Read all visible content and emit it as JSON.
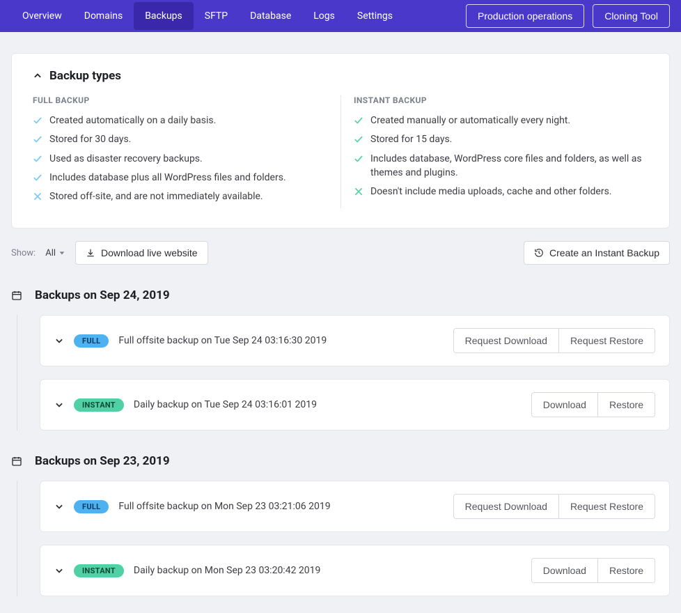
{
  "nav": {
    "items": [
      "Overview",
      "Domains",
      "Backups",
      "SFTP",
      "Database",
      "Logs",
      "Settings"
    ],
    "active_index": 2,
    "right_buttons": [
      "Production operations",
      "Cloning Tool"
    ]
  },
  "panel": {
    "title": "Backup types",
    "full": {
      "heading": "FULL BACKUP",
      "items": [
        {
          "ok": true,
          "text": "Created automatically on a daily basis."
        },
        {
          "ok": true,
          "text": "Stored for 30 days."
        },
        {
          "ok": true,
          "text": "Used as disaster recovery backups."
        },
        {
          "ok": true,
          "text": "Includes database plus all WordPress files and folders."
        },
        {
          "ok": false,
          "text": "Stored off-site, and are not immediately available."
        }
      ]
    },
    "instant": {
      "heading": "INSTANT BACKUP",
      "items": [
        {
          "ok": true,
          "text": "Created manually or automatically every night."
        },
        {
          "ok": true,
          "text": "Stored for 15 days."
        },
        {
          "ok": true,
          "text": "Includes database, WordPress core files and folders, as well as themes and plugins."
        },
        {
          "ok": false,
          "text": "Doesn't include media uploads, cache and other folders."
        }
      ]
    }
  },
  "toolbar": {
    "show_label": "Show:",
    "show_value": "All",
    "download_live": "Download live website",
    "create_instant": "Create an Instant Backup"
  },
  "groups": [
    {
      "heading": "Backups on Sep 24, 2019",
      "rows": [
        {
          "kind": "FULL",
          "text": "Full offsite backup on Tue Sep 24 03:16:30 2019",
          "actions": [
            "Request Download",
            "Request Restore"
          ]
        },
        {
          "kind": "INSTANT",
          "text": "Daily backup on Tue Sep 24 03:16:01 2019",
          "actions": [
            "Download",
            "Restore"
          ]
        }
      ]
    },
    {
      "heading": "Backups on Sep 23, 2019",
      "rows": [
        {
          "kind": "FULL",
          "text": "Full offsite backup on Mon Sep 23 03:21:06 2019",
          "actions": [
            "Request Download",
            "Request Restore"
          ]
        },
        {
          "kind": "INSTANT",
          "text": "Daily backup on Mon Sep 23 03:20:42 2019",
          "actions": [
            "Download",
            "Restore"
          ]
        }
      ]
    }
  ],
  "colors": {
    "check_full": "#7fc9f5",
    "cross_full": "#7fc9f5",
    "check_instant": "#5cd2a6",
    "cross_instant": "#5cd2a6"
  }
}
